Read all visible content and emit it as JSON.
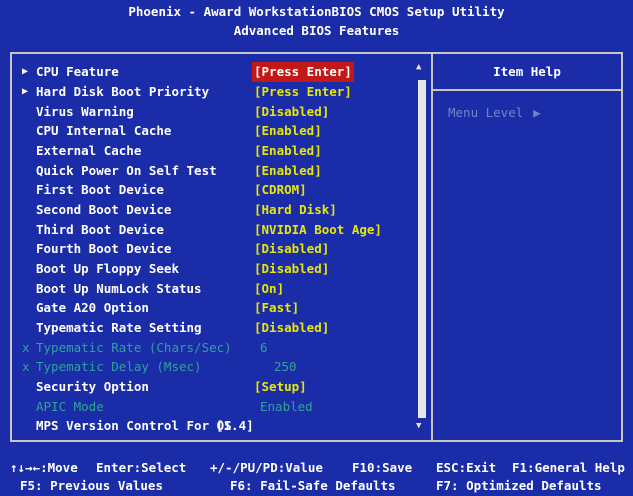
{
  "header": {
    "line1": "Phoenix - Award WorkstationBIOS CMOS Setup Utility",
    "line2": "Advanced BIOS Features"
  },
  "help": {
    "title": "Item Help",
    "menu_level_label": "Menu Level",
    "menu_level_marker": "▶"
  },
  "items": [
    {
      "label": "CPU Feature",
      "value": "[Press Enter]",
      "submenu": true
    },
    {
      "label": "Hard Disk Boot Priority",
      "value": "[Press Enter]",
      "submenu": true
    },
    {
      "label": "Virus Warning",
      "value": "[Disabled]"
    },
    {
      "label": "CPU Internal Cache",
      "value": "[Enabled]"
    },
    {
      "label": "External Cache",
      "value": "[Enabled]"
    },
    {
      "label": "Quick Power On Self Test",
      "value": "[Enabled]"
    },
    {
      "label": "First Boot Device",
      "value": "[CDROM]"
    },
    {
      "label": "Second Boot Device",
      "value": "[Hard Disk]"
    },
    {
      "label": "Third Boot Device",
      "value": "[NVIDIA Boot Age]"
    },
    {
      "label": "Fourth Boot Device",
      "value": "[Disabled]"
    },
    {
      "label": "Boot Up Floppy Seek",
      "value": "[Disabled]"
    },
    {
      "label": "Boot Up NumLock Status",
      "value": "[On]"
    },
    {
      "label": "Gate A20 Option",
      "value": "[Fast]"
    },
    {
      "label": "Typematic Rate Setting",
      "value": "[Disabled]"
    },
    {
      "label": "Typematic Rate (Chars/Sec)",
      "value": "6",
      "prefix": "x"
    },
    {
      "label": "Typematic Delay (Msec)",
      "value": "250",
      "prefix": "x"
    },
    {
      "label": "Security Option",
      "value": "[Setup]"
    },
    {
      "label": "APIC Mode",
      "value": "Enabled"
    },
    {
      "label": "MPS Version Control For OS",
      "value": "[1.4]"
    }
  ],
  "footer": {
    "move": "↑↓→←:Move",
    "select": "Enter:Select",
    "value": "+/-/PU/PD:Value",
    "save": "F10:Save",
    "exit": "ESC:Exit",
    "help": "F1:General Help",
    "prev": "F5: Previous Values",
    "failsafe": "F6: Fail-Safe Defaults",
    "optimized": "F7: Optimized Defaults"
  },
  "scroll": {
    "up_icon": "▲",
    "down_icon": "▼"
  }
}
